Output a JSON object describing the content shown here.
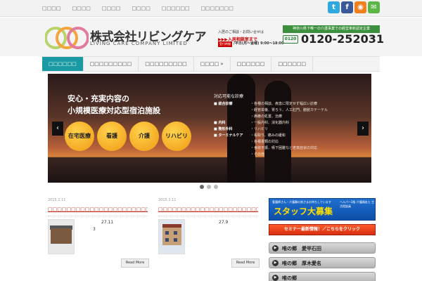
{
  "topnav": [
    "□□□□",
    "□□□□",
    "□□□□",
    "□□□□",
    "□□□□□□",
    "□□□□□□□"
  ],
  "social": {
    "twitter": {
      "glyph": "t",
      "color": "#2fa8e0"
    },
    "facebook": {
      "glyph": "f",
      "color": "#3b5998"
    },
    "rss": {
      "glyph": "◉",
      "color": "#f07f1e"
    },
    "mail": {
      "glyph": "✉",
      "color": "#5cb547"
    }
  },
  "header": {
    "logo_jp": "株式会社リビングケア",
    "logo_en": "LIVING CARE COMPANY LIMITED",
    "note": "入居のご相談・お問い合せは",
    "consult": "▶▶▶入居相談室まで",
    "hours_tag": "受付時間",
    "hours": "/平日(月〜金曜) 9:00〜18:00",
    "green_bar": "神奈川県下唯一の介護事業での経営革新認定企業",
    "phone_icon": "0120",
    "phone": "0120-252031"
  },
  "mainnav": [
    "□□□□□□",
    "□□□□□□□□□",
    "□□□□□□□□□",
    "□□□□ »",
    "□□□□□□",
    "□□□□□□"
  ],
  "slider": {
    "title1": "安心・充実内容の",
    "title2": "小規模医療対応型宿泊施設",
    "circles": [
      "在宅医療",
      "看護",
      "介護",
      "リハビリ"
    ],
    "prev": "‹",
    "next": "›",
    "diag_title": "対応可能な診療",
    "diag_rows": [
      {
        "k": "■ 総合診療",
        "v": "・各種の相談、疾患に限定せず幅広い診療"
      },
      {
        "k": "",
        "v": "・経管栄養、胃ろう、人工肛門、膀胱カテーテル"
      },
      {
        "k": "",
        "v": "・褥瘡の処置、治療"
      },
      {
        "k": "■ 内科",
        "v": "・一般内科、消化器内科"
      },
      {
        "k": "■ 整形外科",
        "v": "・リハビリ"
      },
      {
        "k": "■ ターミナルケア",
        "v": "・看取り、痛みの緩和"
      },
      {
        "k": "",
        "v": "・各種書類の対応"
      },
      {
        "k": "",
        "v": "・食欲不振、嚥下困難など老衰症状の対応"
      },
      {
        "k": "",
        "v": "・その他"
      }
    ]
  },
  "posts": [
    {
      "date": "2015.2.11",
      "title": "□□□□□□□□□□□□□□□□□□□□□□□□□□□□□□",
      "nums": [
        "27.11",
        "3"
      ],
      "readmore": "Read More"
    },
    {
      "date": "2015.2.11",
      "title": "□□□□□□□□□□□□□□□□□□□□□□□□□□□□□□",
      "nums": [
        "27.9"
      ],
      "readmore": "Read More"
    }
  ],
  "sidebar": {
    "staff_sub": "看護師さん・介護職の皆さまお待ちしています",
    "staff_main": "スタッフ大募集",
    "staff_right": "ヘルパー2級 介護福祉士 生活相談員",
    "staff_right2": "生活相談員",
    "seminar": "セミナー最新情報！／こちらをクリック",
    "buttons": [
      {
        "arrow": "▶",
        "label": "唯の郷　愛甲石田"
      },
      {
        "arrow": "▶",
        "label": "唯の郷　厚木愛名"
      },
      {
        "arrow": "▶",
        "label": "唯の郷"
      }
    ]
  },
  "colors": {
    "accent": "#1a9aa2",
    "link_red": "#c0392b",
    "circle_orange": "#f09a12"
  }
}
